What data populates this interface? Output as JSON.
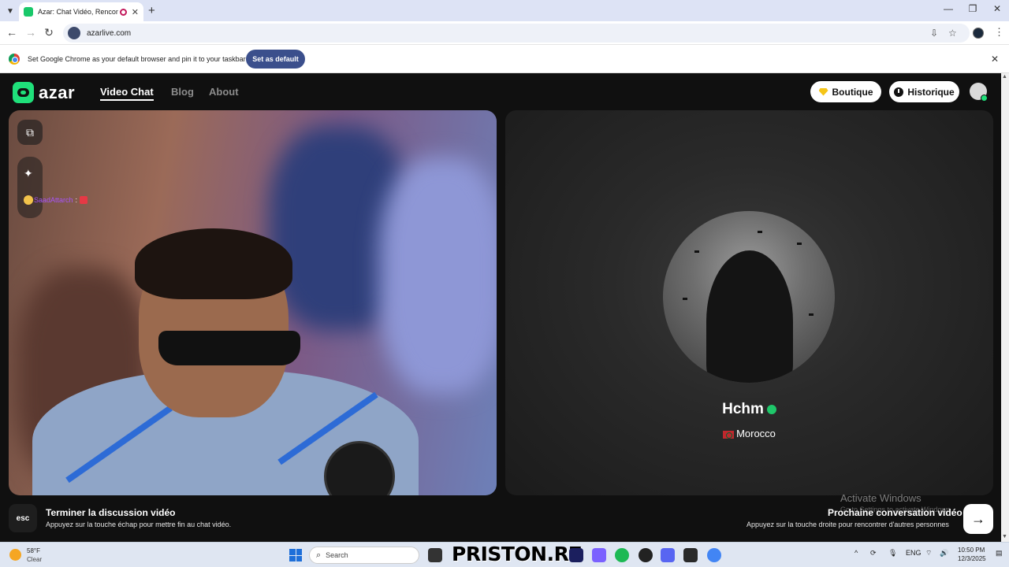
{
  "browser": {
    "tab_title": "Azar: Chat Vidéo, Rencontr",
    "tab_close": "✕",
    "new_tab": "+",
    "url": "azarlive.com",
    "infobar_text": "Set Google Chrome as your default browser and pin it to your taskbar",
    "set_default_label": "Set as default"
  },
  "site": {
    "logo_text": "azar",
    "nav": {
      "video_chat": "Video Chat",
      "blog": "Blog",
      "about": "About"
    },
    "boutique_label": "Boutique",
    "historique_label": "Historique"
  },
  "chat": {
    "username": "SaadAttarch",
    "separator": ":"
  },
  "partner": {
    "name": "Hchm",
    "country": "Morocco"
  },
  "controls": {
    "esc_key": "esc",
    "end_title": "Terminer la discussion vidéo",
    "end_desc": "Appuyez sur la touche échap pour mettre fin au chat vidéo.",
    "next_title": "Prochaine conversation vidéo",
    "next_desc": "Appuyez sur la touche droite pour rencontrer d'autres personnes",
    "next_arrow": "→"
  },
  "windows": {
    "activate_title": "Activate Windows",
    "activate_desc": "Go to Settings to activate Windows."
  },
  "taskbar": {
    "temp": "58°F",
    "condition": "Clear",
    "search_placeholder": "Search",
    "watermark": "PRISTON.R7",
    "lang": "ENG",
    "time": "10:50 PM",
    "date": "12/3/2025"
  },
  "colors": {
    "brand_green": "#1fe07a",
    "chat_name": "#a855f7",
    "infobar_button": "#3b4f8c"
  }
}
